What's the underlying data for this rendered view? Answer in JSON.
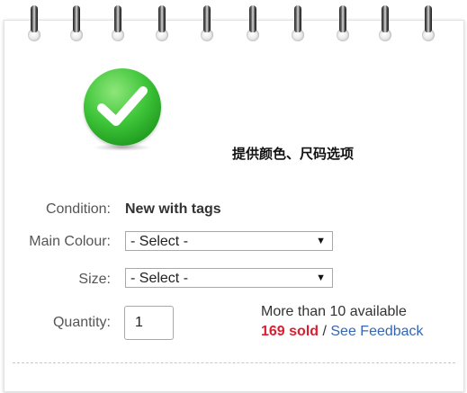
{
  "note": "提供颜色、尺码选项",
  "condition": {
    "label": "Condition:",
    "value": "New with tags"
  },
  "main_colour": {
    "label": "Main Colour:",
    "selected": "- Select -"
  },
  "size": {
    "label": "Size:",
    "selected": "- Select -"
  },
  "quantity": {
    "label": "Quantity:",
    "value": "1"
  },
  "availability": "More than 10 available",
  "sold": "169 sold",
  "sep": " / ",
  "feedback_link": "See Feedback",
  "colors": {
    "sold": "#dd1e31",
    "link": "#3665b3",
    "check": "#3fc53a"
  },
  "icons": {
    "checkmark": "check-circle-icon",
    "dropdown": "triangle-down-icon"
  }
}
